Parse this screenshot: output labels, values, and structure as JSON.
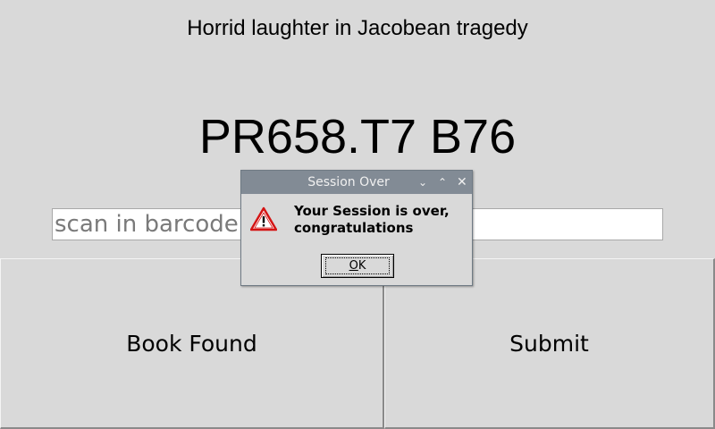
{
  "main": {
    "book_title": "Horrid laughter in Jacobean tragedy",
    "call_number": "PR658.T7 B76",
    "barcode_input": {
      "placeholder": "scan in barcode",
      "value": ""
    },
    "book_found_label": "Book Found",
    "submit_label": "Submit"
  },
  "dialog": {
    "title": "Session Over",
    "message_line1": "Your Session is over,",
    "message_line2": "congratulations",
    "ok_label_mnemonic": "O",
    "ok_label_rest": "K",
    "icons": {
      "minimize": "chevron-down-icon",
      "maximize": "chevron-up-icon",
      "close": "close-icon",
      "message": "warning-icon"
    }
  },
  "colors": {
    "window_bg": "#d9d9d9",
    "titlebar_bg": "#828b95",
    "warning_red": "#d41414"
  }
}
